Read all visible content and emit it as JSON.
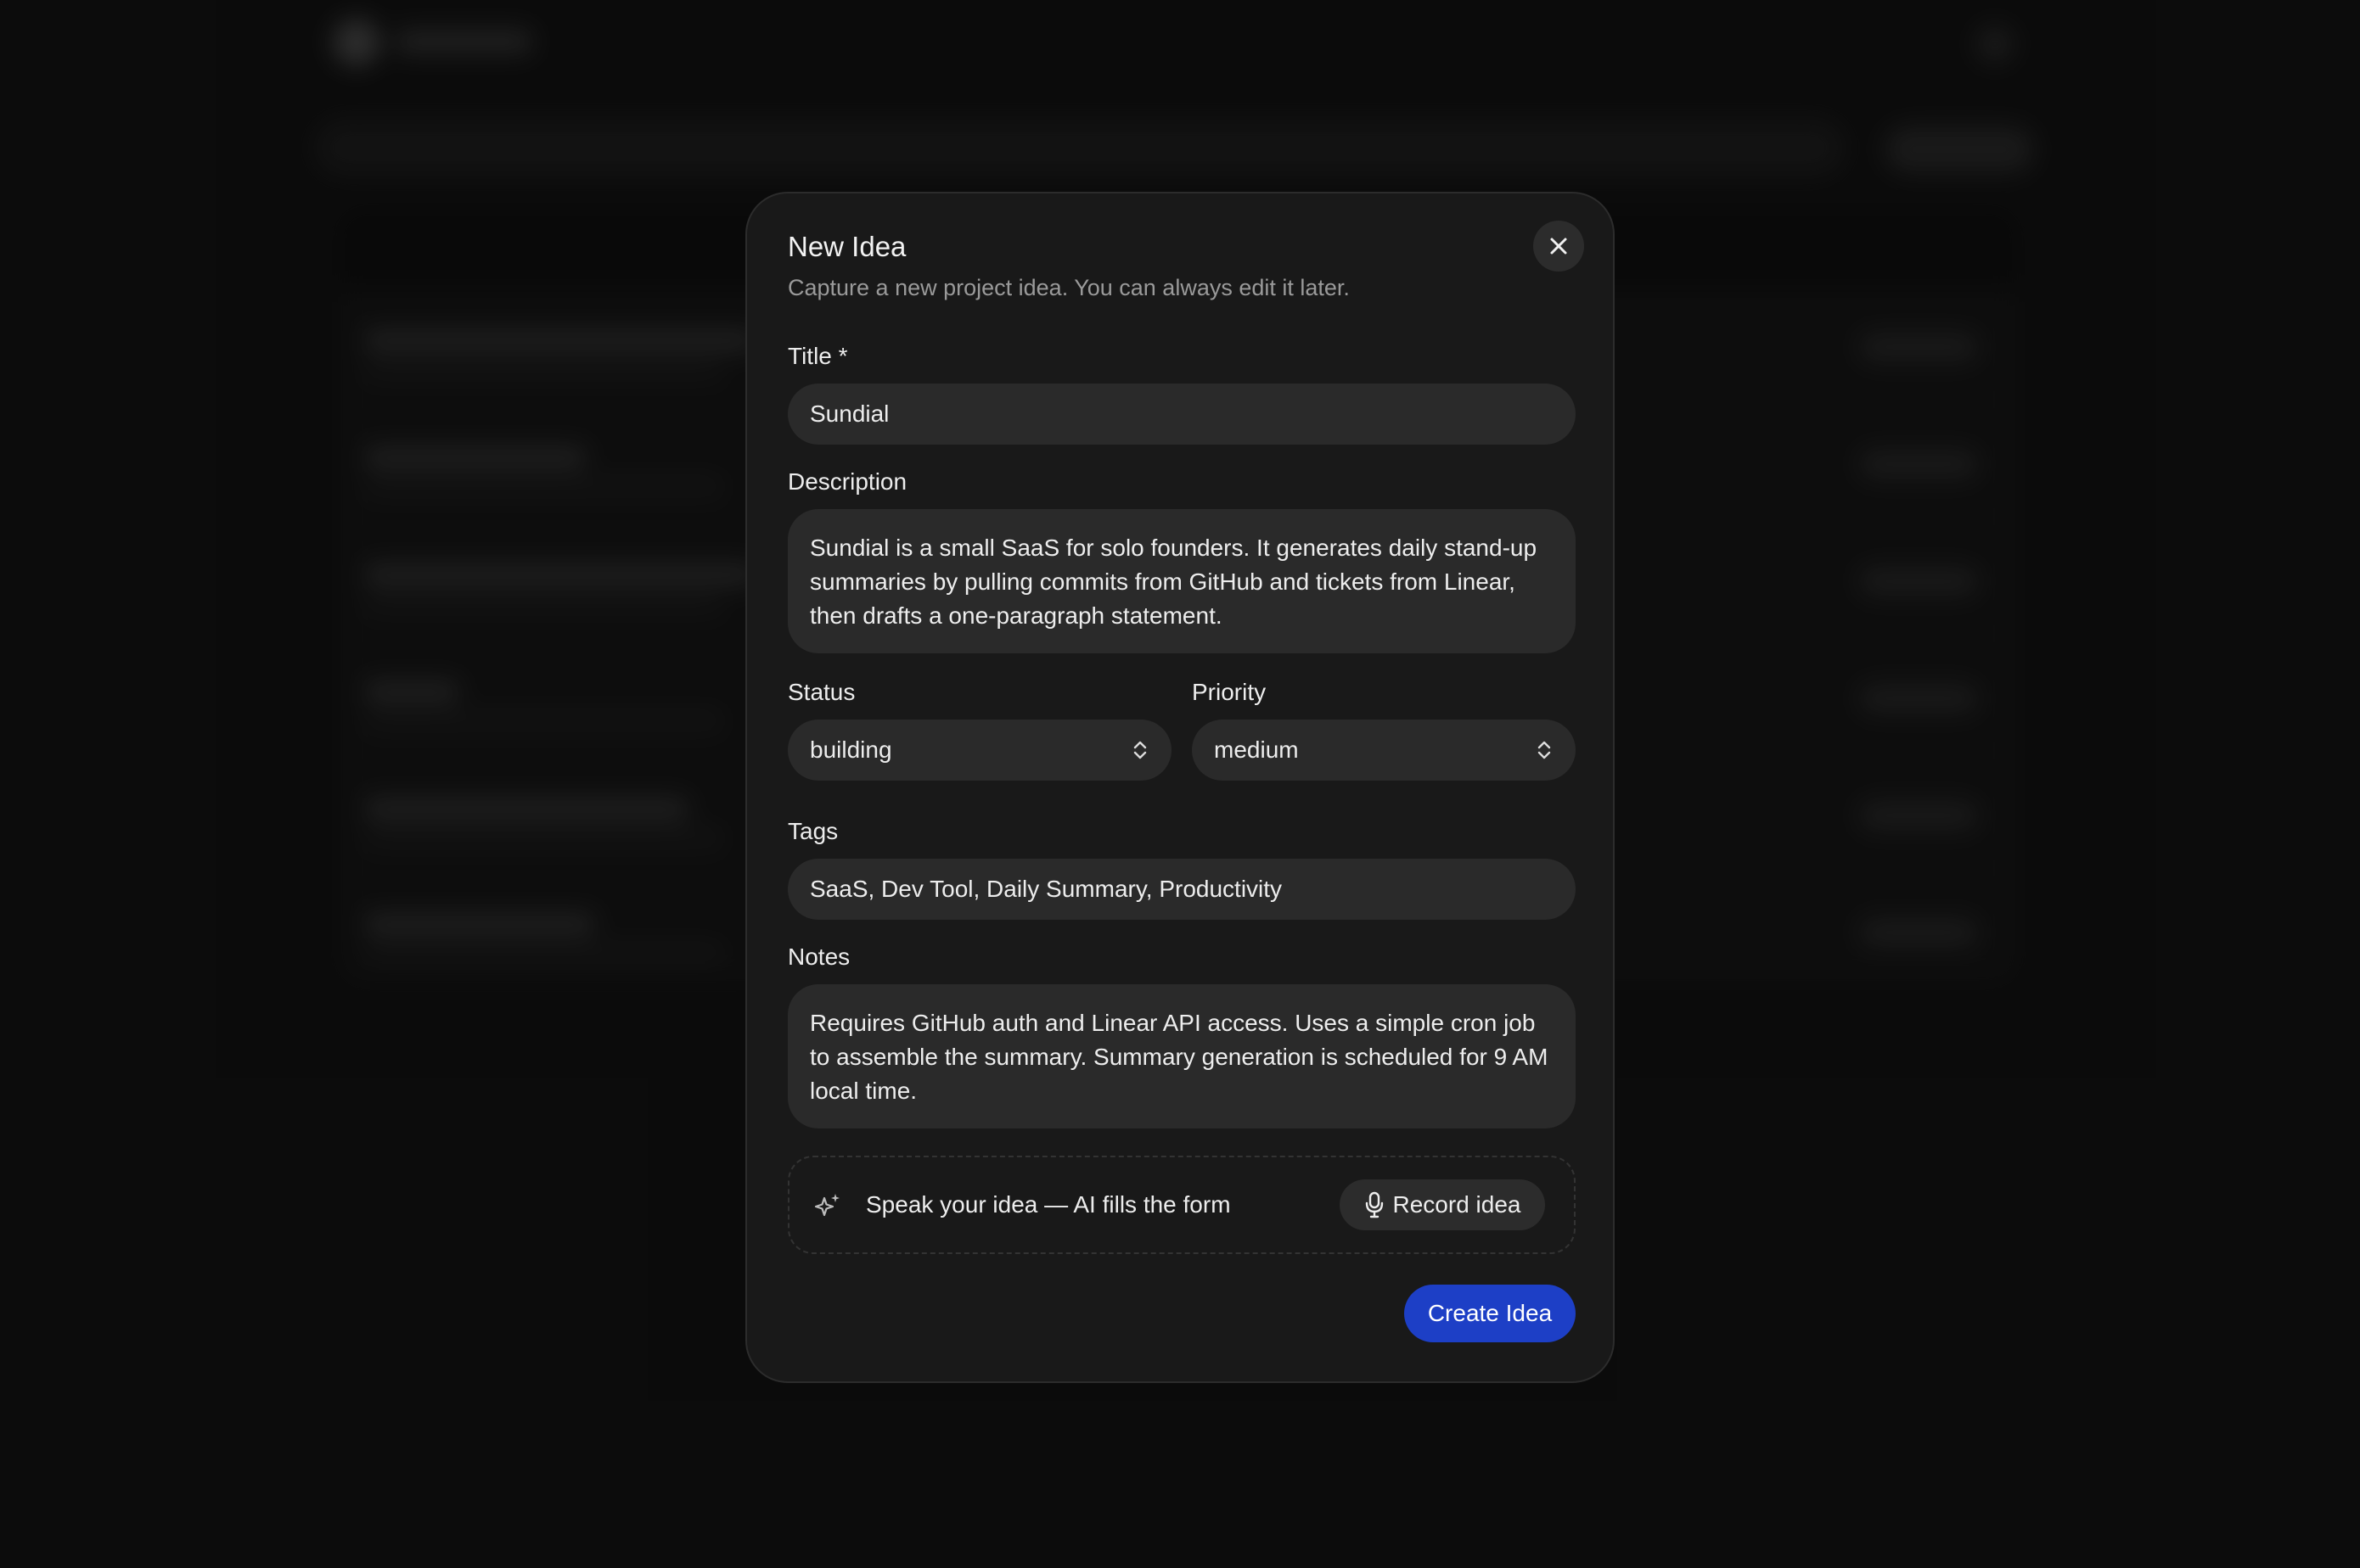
{
  "modal": {
    "title": "New Idea",
    "subtitle": "Capture a new project idea. You can always edit it later.",
    "close_icon": "close-icon"
  },
  "fields": {
    "title": {
      "label": "Title *",
      "value": "Sundial"
    },
    "description": {
      "label": "Description",
      "value": "Sundial is a small SaaS for solo founders. It generates daily stand-up summaries by pulling commits from GitHub and tickets from Linear, then drafts a one-paragraph statement."
    },
    "status": {
      "label": "Status",
      "value": "building",
      "icon": "chevron-up-down-icon"
    },
    "priority": {
      "label": "Priority",
      "value": "medium",
      "icon": "chevron-up-down-icon"
    },
    "tags": {
      "label": "Tags",
      "value": "SaaS, Dev Tool, Daily Summary, Productivity"
    },
    "notes": {
      "label": "Notes",
      "value": "Requires GitHub auth and Linear API access. Uses a simple cron job to assemble the summary. Summary generation is scheduled for 9 AM local time."
    }
  },
  "voice": {
    "icon": "sparkle-icon",
    "prompt": "Speak your idea — AI fills the form",
    "record_label": "Record idea",
    "record_icon": "microphone-icon"
  },
  "actions": {
    "create_label": "Create Idea"
  },
  "colors": {
    "background": "#121212",
    "modal": "#191919",
    "field": "#2a2a2a",
    "accent": "#1d3fc6"
  }
}
